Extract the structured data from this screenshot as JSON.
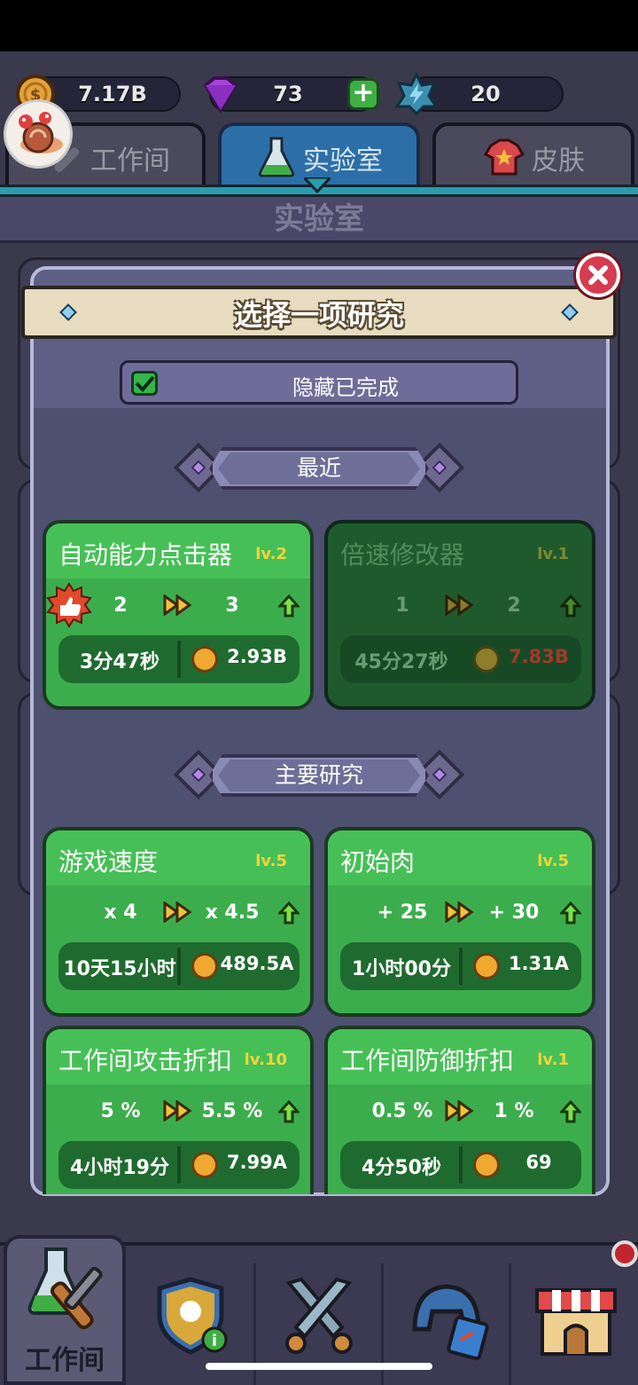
{
  "currencies": {
    "coins": "7.17B",
    "gems": "73",
    "energy": "20",
    "add_label": "+"
  },
  "tabs": [
    {
      "label": "工作间"
    },
    {
      "label": "实验室"
    },
    {
      "label": "皮肤"
    }
  ],
  "page_title": "实验室",
  "modal": {
    "title": "选择一项研究",
    "hide_completed": "隐藏已完成"
  },
  "sections": {
    "recent": "最近",
    "main": "主要研究"
  },
  "cards": [
    {
      "name": "自动能力点击器",
      "level": "lv.2",
      "from": "2",
      "to": "3",
      "time": "3分47秒",
      "cost": "2.93B"
    },
    {
      "name": "倍速修改器",
      "level": "lv.1",
      "from": "1",
      "to": "2",
      "time": "45分27秒",
      "cost": "7.83B"
    },
    {
      "name": "游戏速度",
      "level": "lv.5",
      "from": "x 4",
      "to": "x 4.5",
      "time": "10天15小时",
      "cost": "489.5A"
    },
    {
      "name": "初始肉",
      "level": "lv.5",
      "from": "+ 25",
      "to": "+ 30",
      "time": "1小时00分",
      "cost": "1.31A"
    },
    {
      "name": "工作间攻击折扣",
      "level": "lv.10",
      "from": "5 %",
      "to": "5.5 %",
      "time": "4小时19分",
      "cost": "7.99A"
    },
    {
      "name": "工作间防御折扣",
      "level": "lv.1",
      "from": "0.5 %",
      "to": "1 %",
      "time": "4分50秒",
      "cost": "69"
    }
  ],
  "bottom_nav": {
    "active_label": "工作间"
  },
  "icons": [
    "coin-icon",
    "gem-icon",
    "energy-icon",
    "wrench-icon",
    "flask-icon",
    "shirt-icon",
    "close-icon",
    "checkbox-icon",
    "fast-forward-icon",
    "up-arrow-icon",
    "thumbs-up-icon",
    "info-shield-icon",
    "crossed-swords-icon",
    "helmet-icon",
    "shop-icon",
    "snail-avatar-icon"
  ]
}
